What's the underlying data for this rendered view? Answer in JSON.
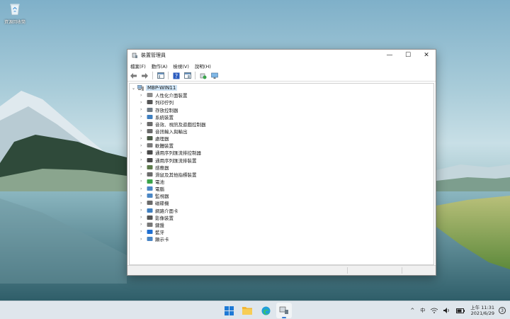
{
  "desktop": {
    "icon_label": "資源回收筒",
    "icon_name": "recycle-bin-icon"
  },
  "window": {
    "title": "裝置管理員",
    "menu": [
      "檔案(F)",
      "動作(A)",
      "檢視(V)",
      "說明(H)"
    ],
    "controls": {
      "minimize": "—",
      "maximize": "☐",
      "close": "✕"
    },
    "tree": {
      "root": "MBP-WIN11",
      "items": [
        {
          "label": "人性化介面裝置",
          "icon": "hid-icon"
        },
        {
          "label": "列印佇列",
          "icon": "printer-icon"
        },
        {
          "label": "存放控制器",
          "icon": "storage-controller-icon"
        },
        {
          "label": "系統裝置",
          "icon": "system-folder-icon"
        },
        {
          "label": "音效、視訊及遊戲控制器",
          "icon": "speaker-icon"
        },
        {
          "label": "音訊輸入與輸出",
          "icon": "audio-io-icon"
        },
        {
          "label": "處理器",
          "icon": "processor-icon"
        },
        {
          "label": "軟體裝置",
          "icon": "software-device-icon"
        },
        {
          "label": "通用序列匯流排控制器",
          "icon": "usb-icon"
        },
        {
          "label": "通用序列匯流排裝置",
          "icon": "usb-icon"
        },
        {
          "label": "感應器",
          "icon": "sensor-icon"
        },
        {
          "label": "滑鼠及其他指標裝置",
          "icon": "mouse-icon"
        },
        {
          "label": "電池",
          "icon": "battery-icon"
        },
        {
          "label": "電腦",
          "icon": "computer-icon"
        },
        {
          "label": "監視器",
          "icon": "monitor-icon"
        },
        {
          "label": "磁碟機",
          "icon": "disk-drive-icon"
        },
        {
          "label": "網路介面卡",
          "icon": "network-adapter-icon"
        },
        {
          "label": "影像裝置",
          "icon": "camera-icon"
        },
        {
          "label": "鍵盤",
          "icon": "keyboard-icon"
        },
        {
          "label": "藍牙",
          "icon": "bluetooth-icon"
        },
        {
          "label": "顯示卡",
          "icon": "display-adapter-icon"
        }
      ]
    }
  },
  "taskbar": {
    "tray_ime": "中",
    "time": "上午 11:31",
    "date": "2021/6/29",
    "notifications": "3"
  },
  "colors": {
    "accent": "#3b7fd6",
    "selection": "#cde3f5",
    "taskbar": "#dfe6ec"
  }
}
